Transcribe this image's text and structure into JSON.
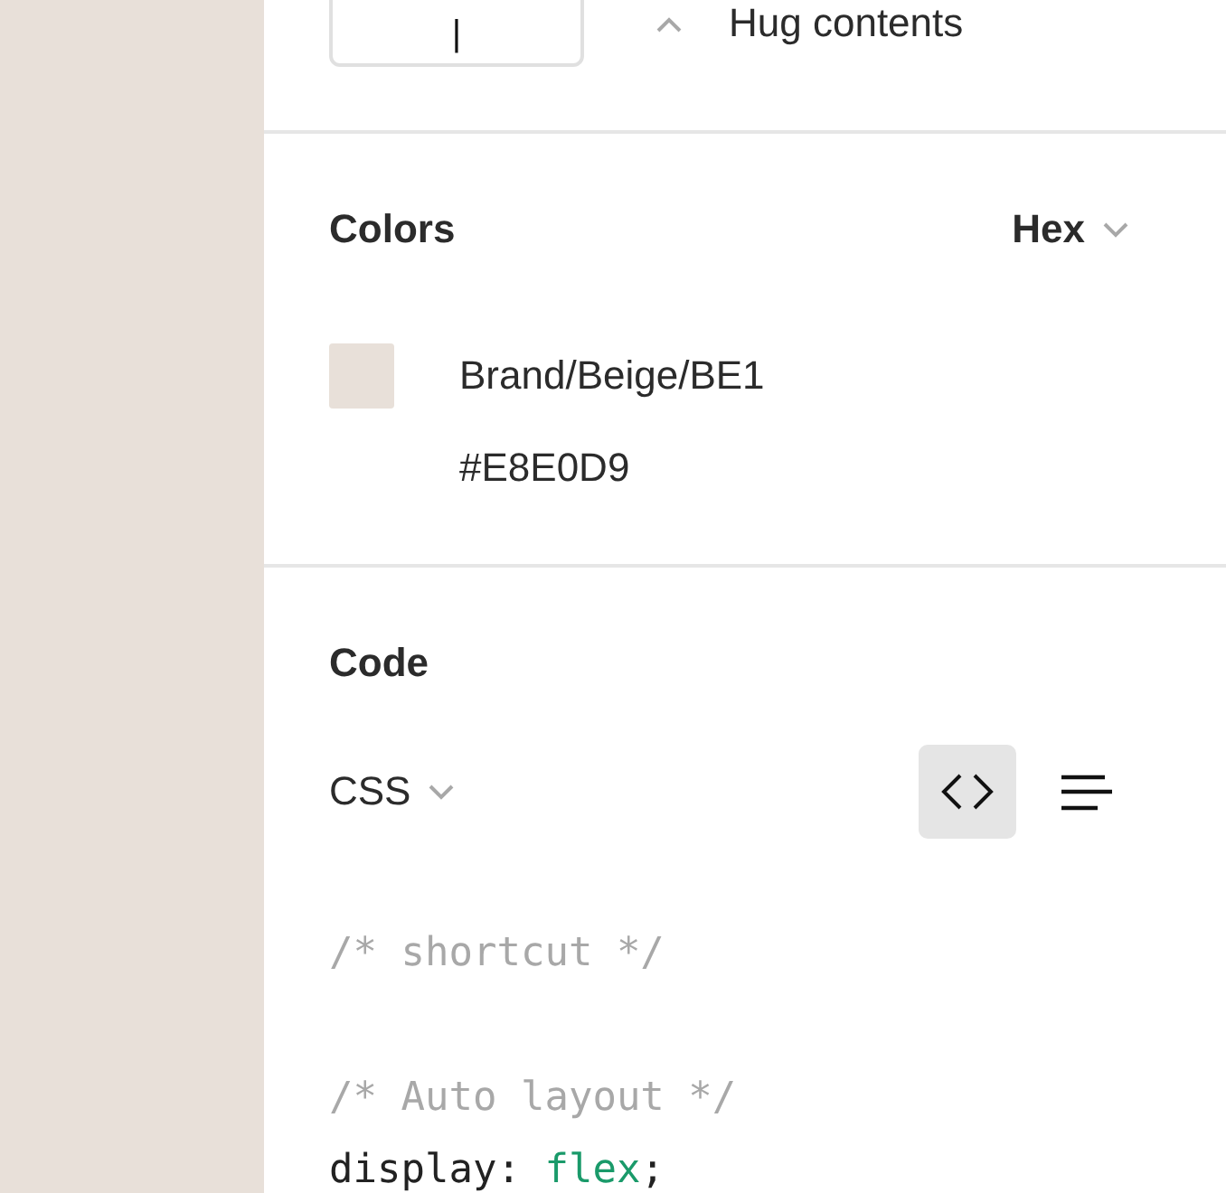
{
  "sizing": {
    "field_value": "|",
    "option": "Hug contents"
  },
  "colors": {
    "title": "Colors",
    "format": "Hex",
    "items": [
      {
        "name": "Brand/Beige/BE1",
        "value": "#E8E0D9",
        "color": "#e8e0d9"
      }
    ]
  },
  "code": {
    "title": "Code",
    "language": "CSS",
    "views": [
      {
        "kind": "code",
        "selected": true
      },
      {
        "kind": "list",
        "selected": false
      }
    ],
    "lines": [
      {
        "tokens": [
          {
            "kind": "comment",
            "text": "/* shortcut */"
          }
        ]
      },
      {
        "kind": "blank"
      },
      {
        "tokens": [
          {
            "kind": "comment",
            "text": "/* Auto layout */"
          }
        ]
      },
      {
        "tokens": [
          {
            "kind": "property",
            "text": "display: "
          },
          {
            "kind": "value",
            "text": "flex"
          },
          {
            "kind": "punct",
            "text": ";"
          }
        ]
      }
    ]
  }
}
